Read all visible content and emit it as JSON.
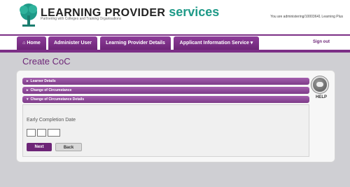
{
  "header": {
    "brand_main": "LEARNING PROVIDER",
    "brand_accent": "services",
    "tagline": "Partnering with Colleges and Training Organisations",
    "user_info": "You are administering/10003641 Learning Plus"
  },
  "nav": {
    "tabs": [
      {
        "label": "⌂ Home"
      },
      {
        "label": "Administer User"
      },
      {
        "label": "Learning Provider Details"
      },
      {
        "label": "Applicant Information Service ▾"
      }
    ],
    "signout": "Sign out"
  },
  "page": {
    "title": "Create CoC"
  },
  "accordion": {
    "arrow_collapsed": "▸",
    "arrow_expanded": "▾",
    "sections": [
      {
        "label": "Learner Details",
        "expanded": false
      },
      {
        "label": "Change of Circumstance",
        "expanded": false
      },
      {
        "label": "Change of Circumstance Details",
        "expanded": true
      }
    ]
  },
  "form": {
    "field_label": "Early Completion Date",
    "date_values": [
      "",
      "",
      ""
    ],
    "next_label": "Next",
    "back_label": "Back"
  },
  "help": {
    "label": "HELP"
  },
  "colors": {
    "brand_purple": "#6d2577",
    "accent_teal": "#1f9a88"
  }
}
